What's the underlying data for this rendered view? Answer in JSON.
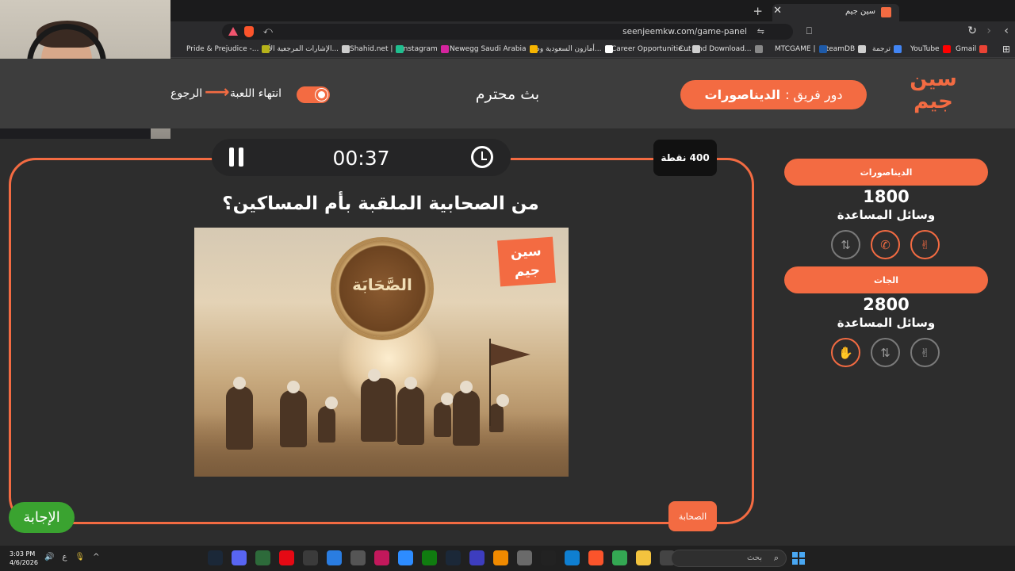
{
  "browser": {
    "tab_title": "سين جيم",
    "url": "seenjeemkw.com/game-panel",
    "bookmarks": [
      {
        "label": "Gmail",
        "color": "#ea4335"
      },
      {
        "label": "YouTube",
        "color": "#ff0000"
      },
      {
        "label": "ترجمة",
        "color": "#4285f4"
      },
      {
        "label": "SteamDB",
        "color": "#cfcfcf"
      },
      {
        "label": "MTCGAME |",
        "color": "#1e5aa8"
      },
      {
        "label": "Cut and Download...",
        "color": "#888888"
      },
      {
        "label": "Career Opportunitie...",
        "color": "#cfcfcf"
      },
      {
        "label": "أمازون السعودية وض...",
        "color": "#ffffff"
      },
      {
        "label": "Newegg Saudi Arabia",
        "color": "#f7b500"
      },
      {
        "label": "Instagram",
        "color": "#d6249f"
      },
      {
        "label": "Shahid.net |",
        "color": "#1fbf8f"
      },
      {
        "label": "الإشارات المرجعية الأ...",
        "color": "#cccccc"
      },
      {
        "label": "Pride & Prejudice -...",
        "color": "#b7b31a"
      }
    ]
  },
  "header": {
    "turn_label": "دور فريق :",
    "turn_team": "الديناصورات",
    "stream_title": "بث محترم",
    "end_game": "انتهاء اللعبة",
    "back": "الرجوع",
    "logo_top": "سين",
    "logo_bottom": "جيم"
  },
  "question_panel": {
    "timer": "00:37",
    "points": "400 نقطة",
    "question": "من الصحابية الملقبة بأم المساكين؟",
    "image_medallion_text": "الصَّحَابَة",
    "image_logo_top": "سين",
    "image_logo_bottom": "جيم",
    "category": "الصحابة",
    "answer_button": "الإجابة"
  },
  "teams": [
    {
      "name": "الديناصورات",
      "score": "1800",
      "aids_label": "وسائل المساعدة",
      "aids": [
        "swap-icon",
        "phone-icon",
        "peace-hand-icon"
      ],
      "active_aids": [
        false,
        true,
        true
      ]
    },
    {
      "name": "الجات",
      "score": "2800",
      "aids_label": "وسائل المساعدة",
      "aids": [
        "hand-stop-icon",
        "swap-icon",
        "peace-hand-icon"
      ],
      "active_aids": [
        true,
        false,
        false
      ]
    }
  ],
  "taskbar": {
    "time": "3:03 PM",
    "date": "4/6/2026",
    "lang": "ع",
    "search_placeholder": "بحث"
  },
  "colors": {
    "accent": "#f36b42",
    "answer_green": "#3aa330",
    "background": "#2d2d2d"
  }
}
